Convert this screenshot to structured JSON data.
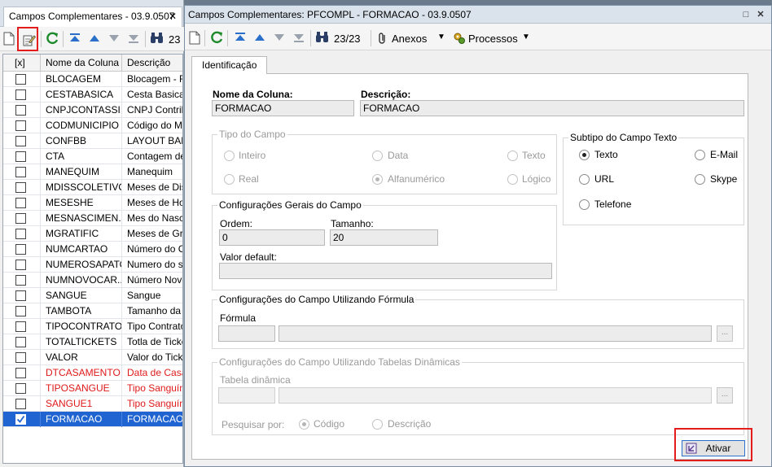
{
  "left_window": {
    "tab_title": "Campos Complementares - 03.9.0507",
    "close_glyph": "✕",
    "columns": [
      "[x]",
      "Nome da Coluna",
      "Descrição"
    ],
    "rows": [
      {
        "name": "BLOCAGEM",
        "desc": "Blocagem - RE",
        "checked": false,
        "red": false
      },
      {
        "name": "CESTABASICA",
        "desc": "Cesta Basica",
        "checked": false,
        "red": false
      },
      {
        "name": "CNPJCONTASSI...",
        "desc": "CNPJ Contribui",
        "checked": false,
        "red": false
      },
      {
        "name": "CODMUNICIPIO",
        "desc": "Código do Mun",
        "checked": false,
        "red": false
      },
      {
        "name": "CONFBB",
        "desc": "LAYOUT BANC",
        "checked": false,
        "red": false
      },
      {
        "name": "CTA",
        "desc": "Contagem de T",
        "checked": false,
        "red": false
      },
      {
        "name": "MANEQUIM",
        "desc": "Manequim",
        "checked": false,
        "red": false
      },
      {
        "name": "MDISSCOLETIVO",
        "desc": "Meses de Diss",
        "checked": false,
        "red": false
      },
      {
        "name": "MESESHE",
        "desc": "Meses de Hora",
        "checked": false,
        "red": false
      },
      {
        "name": "MESNASCIMEN...",
        "desc": "Mes do Nascim",
        "checked": false,
        "red": false
      },
      {
        "name": "MGRATIFIC",
        "desc": "Meses de Grati",
        "checked": false,
        "red": false
      },
      {
        "name": "NUMCARTAO",
        "desc": "Número do Car",
        "checked": false,
        "red": false
      },
      {
        "name": "NUMEROSAPATO",
        "desc": "Numero do sap",
        "checked": false,
        "red": false
      },
      {
        "name": "NUMNOVOCAR...",
        "desc": "Número Novo C",
        "checked": false,
        "red": false
      },
      {
        "name": "SANGUE",
        "desc": "Sangue",
        "checked": false,
        "red": false
      },
      {
        "name": "TAMBOTA",
        "desc": "Tamanho da B",
        "checked": false,
        "red": false
      },
      {
        "name": "TIPOCONTRATO",
        "desc": "Tipo Contrato F",
        "checked": false,
        "red": false
      },
      {
        "name": "TOTALTICKETS",
        "desc": "Totla de Ticket",
        "checked": false,
        "red": false
      },
      {
        "name": "VALOR",
        "desc": "Valor do Ticket",
        "checked": false,
        "red": false
      },
      {
        "name": "DTCASAMENTO",
        "desc": "Data de Casam",
        "checked": false,
        "red": true
      },
      {
        "name": "TIPOSANGUE",
        "desc": "Tipo Sanguíne",
        "checked": false,
        "red": true
      },
      {
        "name": "SANGUE1",
        "desc": "Tipo Sanguíne",
        "checked": false,
        "red": true
      },
      {
        "name": "FORMACAO",
        "desc": "FORMACAO",
        "checked": true,
        "red": false
      }
    ],
    "counter": "23"
  },
  "right_window": {
    "title": "Campos Complementares: PFCOMPL - FORMACAO - 03.9.0507",
    "toolbar": {
      "counter": "23/23",
      "anexos": "Anexos",
      "processos": "Processos"
    },
    "tab": "Identificação",
    "nome_label": "Nome da Coluna:",
    "nome_value": "FORMACAO",
    "desc_label": "Descrição:",
    "desc_value": "FORMACAO",
    "tipo_campo": {
      "title": "Tipo do Campo",
      "options": [
        "Inteiro",
        "Data",
        "Texto",
        "Real",
        "Alfanumérico",
        "Lógico"
      ],
      "selected": "Alfanumérico"
    },
    "subtipo": {
      "title": "Subtipo do Campo Texto",
      "options": [
        "Texto",
        "E-Mail",
        "URL",
        "Skype",
        "Telefone"
      ],
      "selected": "Texto"
    },
    "config_gerais": {
      "title": "Configurações Gerais do Campo",
      "ordem_label": "Ordem:",
      "ordem_value": "0",
      "tamanho_label": "Tamanho:",
      "tamanho_value": "20",
      "default_label": "Valor default:",
      "default_value": ""
    },
    "config_formula": {
      "title": "Configurações do Campo Utilizando Fórmula",
      "formula_label": "Fórmula",
      "dots": "..."
    },
    "config_tabelas": {
      "title": "Configurações do Campo Utilizando Tabelas Dinâmicas",
      "tabela_label": "Tabela dinâmica",
      "pesquisar_label": "Pesquisar por:",
      "options": [
        "Código",
        "Descrição"
      ],
      "selected": "Código",
      "dots": "..."
    },
    "ativar": "Ativar",
    "controls": {
      "restore": "□",
      "close": "✕"
    }
  },
  "colors": {
    "selection": "#1f64d0",
    "highlight": "#e41c1c",
    "red_text": "#e0191a"
  }
}
